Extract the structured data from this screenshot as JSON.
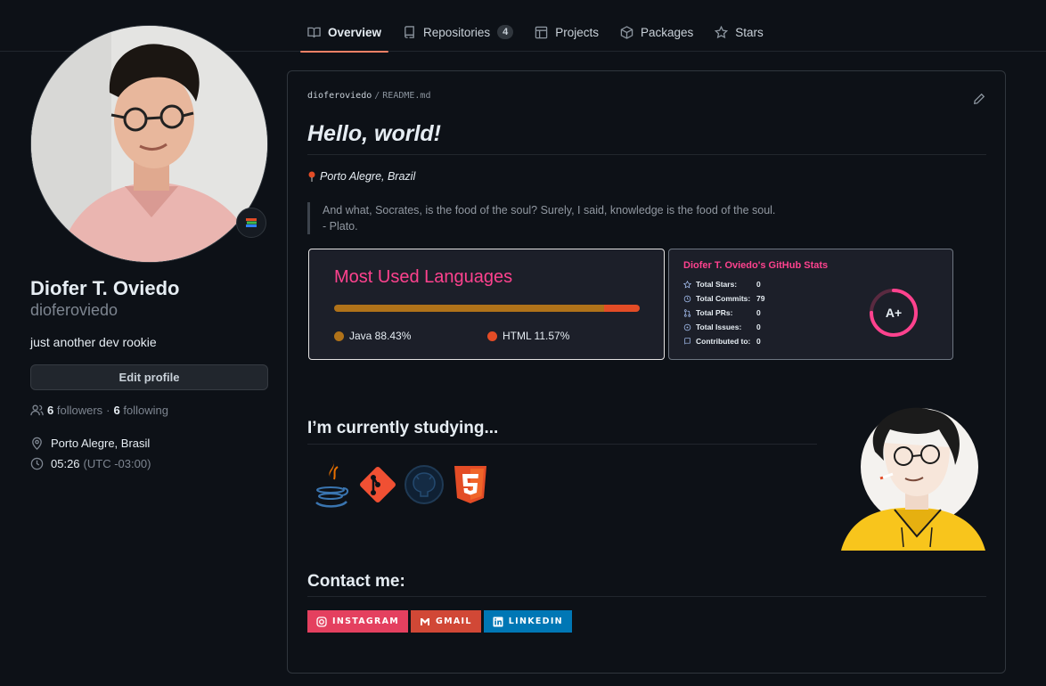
{
  "nav": {
    "tabs": [
      {
        "label": "Overview",
        "icon": "book-icon",
        "active": true
      },
      {
        "label": "Repositories",
        "icon": "repo-icon",
        "count": "4"
      },
      {
        "label": "Projects",
        "icon": "table-icon"
      },
      {
        "label": "Packages",
        "icon": "package-icon"
      },
      {
        "label": "Stars",
        "icon": "star-icon"
      }
    ]
  },
  "profile": {
    "full_name": "Diofer T. Oviedo",
    "username": "dioferoviedo",
    "bio": "just another dev rookie",
    "edit_label": "Edit profile",
    "followers_count": "6",
    "followers_label": "followers",
    "separator": "·",
    "following_count": "6",
    "following_label": "following",
    "location": "Porto Alegre, Brasil",
    "local_time": "05:26",
    "timezone": "(UTC -03:00)",
    "status_icon": "books-emoji-icon"
  },
  "readme": {
    "owner": "dioferoviedo",
    "separator": "/",
    "file": "README.md",
    "heading": "Hello, world!",
    "location": "Porto Alegre, Brazil",
    "quote_line1": "And what, Socrates, is the food of the soul? Surely, I said, knowledge is the food of the soul.",
    "quote_line2": "- Plato.",
    "languages_card": {
      "title": "Most Used Languages",
      "languages": [
        {
          "name": "Java",
          "percent": 88.43,
          "label": "Java 88.43%",
          "color": "#b07219"
        },
        {
          "name": "HTML",
          "percent": 11.57,
          "label": "HTML 11.57%",
          "color": "#e34c26"
        }
      ]
    },
    "stats_card": {
      "title": "Diofer T. Oviedo's GitHub Stats",
      "rows": [
        {
          "label": "Total Stars:",
          "value": "0",
          "icon": "star-icon"
        },
        {
          "label": "Total Commits:",
          "value": "79",
          "icon": "history-icon"
        },
        {
          "label": "Total PRs:",
          "value": "0",
          "icon": "pull-request-icon"
        },
        {
          "label": "Total Issues:",
          "value": "0",
          "icon": "issue-icon"
        },
        {
          "label": "Contributed to:",
          "value": "0",
          "icon": "repo-icon"
        }
      ],
      "rank": "A+",
      "rank_progress": 0.75,
      "colors": {
        "title": "#fe428e",
        "ring": "#fe428e"
      }
    },
    "studying_heading": "I’m currently studying...",
    "technologies": [
      "java-icon",
      "git-icon",
      "github-icon",
      "html5-icon"
    ],
    "contact_heading": "Contact me:",
    "contacts": [
      {
        "label": "INSTAGRAM",
        "color": "#e4405f",
        "icon": "instagram-icon"
      },
      {
        "label": "GMAIL",
        "color": "#d14836",
        "icon": "gmail-icon"
      },
      {
        "label": "LINKEDIN",
        "color": "#0077b5",
        "icon": "linkedin-icon"
      }
    ]
  }
}
